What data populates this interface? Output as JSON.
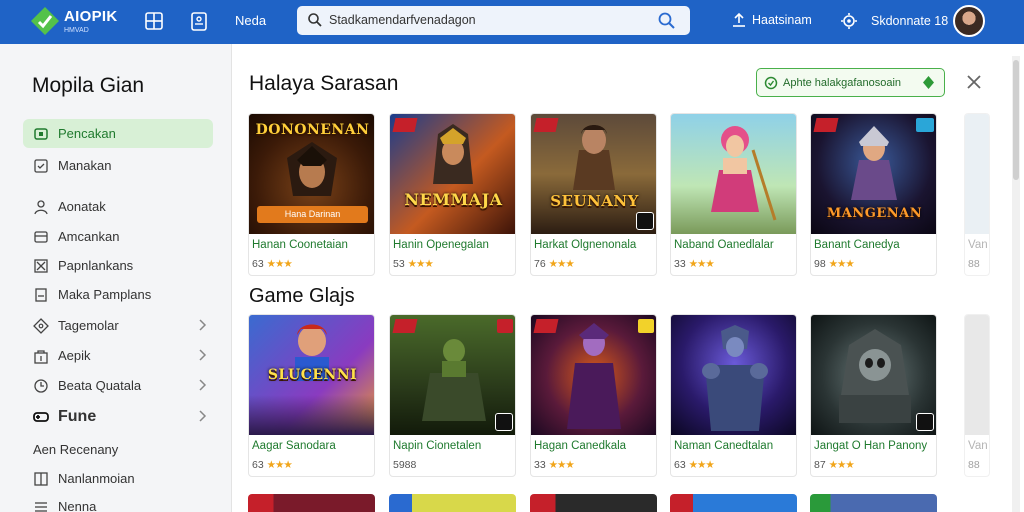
{
  "header": {
    "logo_line1": "AIOPIK",
    "logo_line2": "HMVAD",
    "nav_label": "Neda",
    "search_text": "Stadkamendarfvenadagon",
    "upload_label": "Haatsinam",
    "notif_label": "Skdonnate 18"
  },
  "sidebar": {
    "title": "Mopila Gian",
    "items": [
      {
        "label": "Pencakan",
        "icon": "gamepad-icon",
        "active": true
      },
      {
        "label": "Manakan",
        "icon": "square-icon"
      },
      {
        "label": "Aonatak",
        "icon": "user-icon"
      },
      {
        "label": "Amcankan",
        "icon": "folder-icon"
      },
      {
        "label": "Papnlankans",
        "icon": "box-x-icon"
      },
      {
        "label": "Maka Pamplans",
        "icon": "document-icon"
      },
      {
        "label": "Tagemolar",
        "icon": "tag-icon",
        "chevron": true
      },
      {
        "label": "Aepik",
        "icon": "bag-icon",
        "chevron": true
      },
      {
        "label": "Beata Quatala",
        "icon": "clock-icon",
        "chevron": true
      },
      {
        "label": "Fune",
        "icon": "gamepad-icon",
        "chevron": true,
        "bold": true
      },
      {
        "label": "Aen Recenany",
        "icon": ""
      },
      {
        "label": "Nanlanmoian",
        "icon": "grid-icon"
      },
      {
        "label": "Nenna",
        "icon": "list-icon"
      }
    ]
  },
  "main": {
    "title": "Halaya Sarasan",
    "promo": "Aphte halakgafanosoain",
    "section2_title": "Game Glajs",
    "row1": [
      {
        "art_title": "DONONENAN",
        "art_button": "Hana Darinan",
        "name": "Hanan Coonetaian",
        "rating": "63"
      },
      {
        "art_title": "NEMMAJA",
        "name": "Hanin Openegalan",
        "rating": "53"
      },
      {
        "art_title": "SEUNANY",
        "name": "Harkat Olgnenonala",
        "rating": "76"
      },
      {
        "art_title": "",
        "name": "Naband Oanedlalar",
        "rating": "33"
      },
      {
        "art_title": "MANGENAN",
        "name": "Banant Canedya",
        "rating": "98"
      }
    ],
    "row1_partial": {
      "name": "Van",
      "rating": "88"
    },
    "row2": [
      {
        "art_title": "SLUCENNI",
        "name": "Aagar Sanodara",
        "rating": "63"
      },
      {
        "art_title": "",
        "name": "Napin Cionetalen",
        "rating": "5988"
      },
      {
        "art_title": "",
        "name": "Hagan Canedkala",
        "rating": "33"
      },
      {
        "art_title": "",
        "name": "Naman Canedtalan",
        "rating": "63"
      },
      {
        "art_title": "",
        "name": "Jangat O Han Panony",
        "rating": "87"
      }
    ],
    "row2_partial": {
      "name": "Van",
      "rating": "88"
    }
  },
  "colors": {
    "header_bg": "#1f63c6",
    "accent_green": "#1f7a2e",
    "active_bg": "#d8f0d6",
    "star": "#f1a51a"
  }
}
